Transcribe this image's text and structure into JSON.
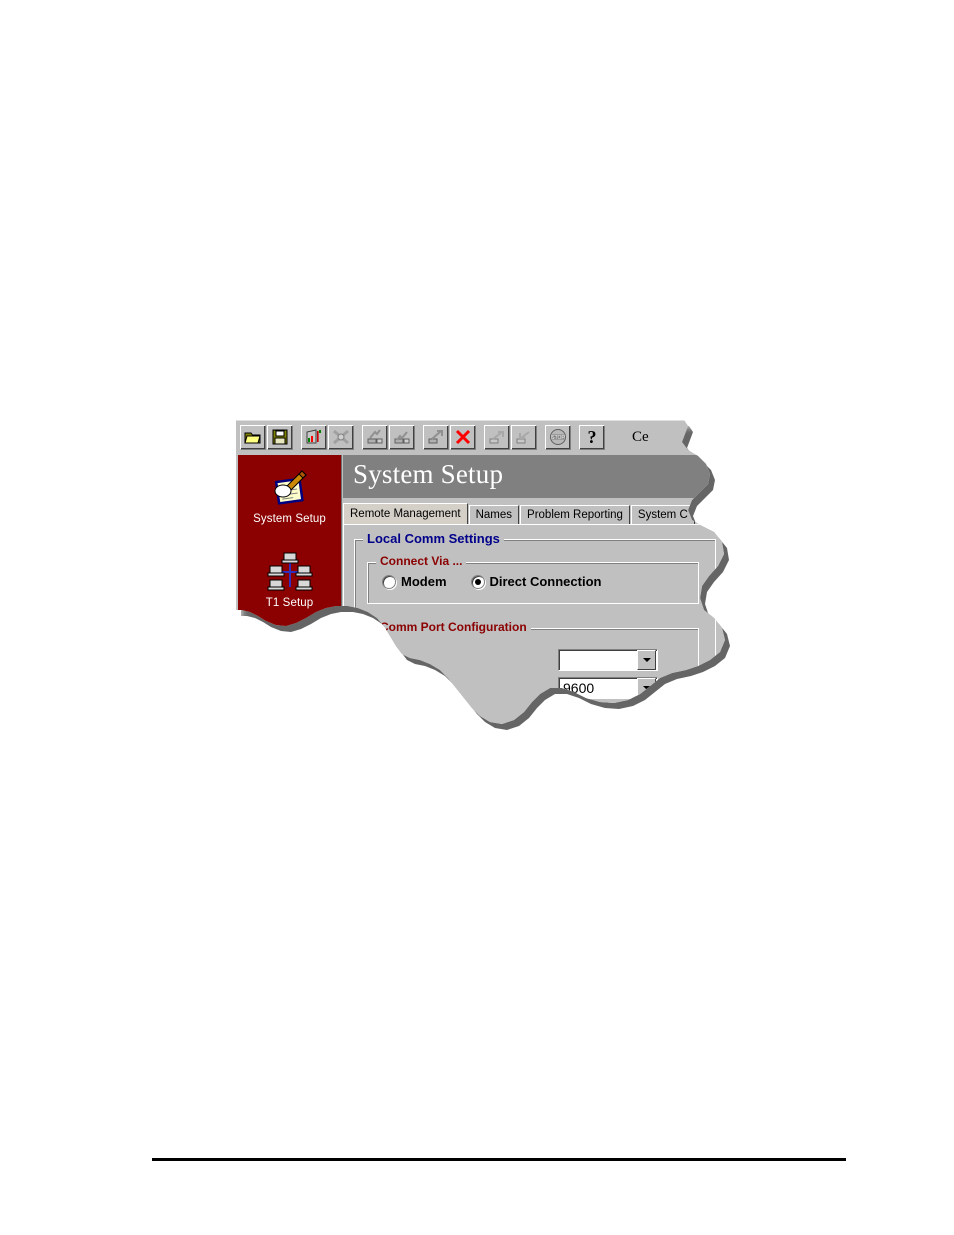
{
  "page": {
    "background": "#ffffff",
    "footer_rule_color": "#000000"
  },
  "app": {
    "toolbar": {
      "buttons": [
        {
          "name": "open-file",
          "icon": "folder-open-icon"
        },
        {
          "name": "save-file",
          "icon": "floppy-disk-save-icon"
        },
        {
          "name": "chart-report",
          "icon": "bar-chart-icon"
        },
        {
          "name": "disconnect-all",
          "icon": "crossed-link-icon"
        },
        {
          "name": "upload-left",
          "icon": "transfer-up-icon"
        },
        {
          "name": "download-right",
          "icon": "transfer-down-icon"
        },
        {
          "name": "transfer-config",
          "icon": "transfer-arrow-icon"
        },
        {
          "name": "delete-connection",
          "icon": "red-x-icon"
        },
        {
          "name": "send-config",
          "icon": "send-arrow-icon"
        },
        {
          "name": "receive-config",
          "icon": "receive-arrow-icon"
        },
        {
          "name": "stop-operation",
          "icon": "stop-sign-icon"
        },
        {
          "name": "help",
          "icon": "question-mark-icon"
        }
      ],
      "caption_truncated": "Ce"
    },
    "sidebar": {
      "background": "#8b0000",
      "items": [
        {
          "label": "System Setup",
          "icon": "clipboard-pencil-icon",
          "selected": true
        },
        {
          "label": "T1 Setup",
          "icon": "network-computers-icon",
          "selected": false
        }
      ]
    },
    "title": "System Setup",
    "title_bar_color": "#808080",
    "tabs": [
      {
        "label": "Remote Management",
        "active": true
      },
      {
        "label": "Names",
        "active": false
      },
      {
        "label": "Problem Reporting",
        "active": false
      },
      {
        "label": "System C",
        "active": false,
        "truncated": true
      }
    ],
    "panel": {
      "local_comm_settings": {
        "legend": "Local Comm Settings",
        "legend_color": "#00008b",
        "connect_via": {
          "legend": "Connect Via ...",
          "legend_color": "#8b0000",
          "options": [
            {
              "label": "Modem",
              "selected": false
            },
            {
              "label": "Direct Connection",
              "selected": true
            }
          ]
        },
        "comm_port_configuration": {
          "legend": "Comm Port Configuration",
          "legend_color": "#8b0000",
          "fields": [
            {
              "name": "comm-port-select",
              "value": ""
            },
            {
              "name": "baud-rate-select",
              "value": "9600"
            }
          ]
        }
      }
    }
  }
}
